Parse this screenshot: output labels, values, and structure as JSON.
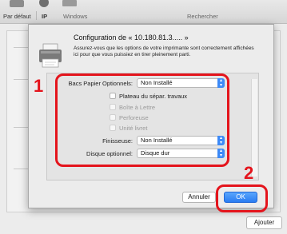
{
  "toolbar": {
    "items": [
      {
        "label": "Par défaut",
        "icon": "default-printers-icon"
      },
      {
        "label": "IP",
        "icon": "ip-globe-icon"
      },
      {
        "label": "Windows",
        "icon": "windows-icon"
      }
    ],
    "search_label": "Rechercher"
  },
  "dialog": {
    "title": "Configuration de « 10.180.81.3..... »",
    "description": "Assurez-vous que les options de votre imprimante sont correctement affichées ici pour que vous puissiez en tirer pleinement parti.",
    "paper_trays_label": "Bacs Papier Optionnels:",
    "paper_trays_value": "Non Installé",
    "checkboxes": [
      {
        "label": "Plateau du sépar. travaux",
        "enabled": true
      },
      {
        "label": "Boîte à Lettre",
        "enabled": false
      },
      {
        "label": "Perforeuse",
        "enabled": false
      },
      {
        "label": "Unité livret",
        "enabled": false
      }
    ],
    "finisher_label": "Finisseuse:",
    "finisher_value": "Non Installé",
    "disk_label": "Disque optionnel:",
    "disk_value": "Disque dur",
    "cancel_label": "Annuler",
    "ok_label": "OK"
  },
  "add_button_label": "Ajouter",
  "annotations": {
    "step1": "1",
    "step2": "2",
    "color": "#e4141c"
  },
  "colors": {
    "accent": "#3d8af7",
    "ok_button": "#2a7cf2"
  }
}
